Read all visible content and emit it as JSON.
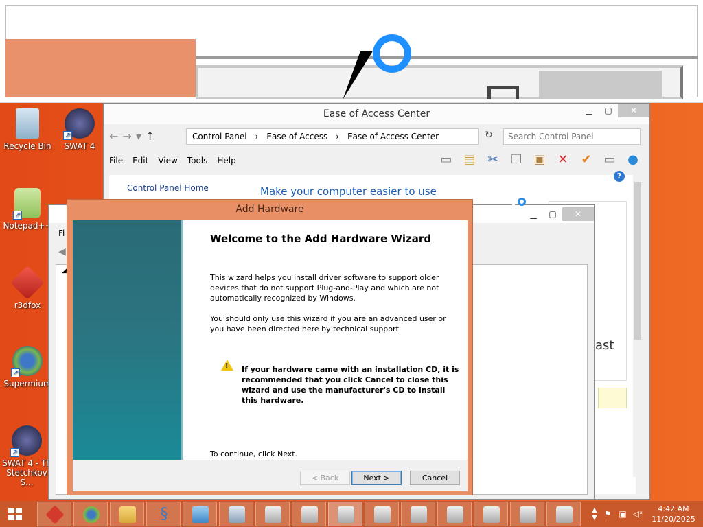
{
  "desktop": {
    "icons": [
      {
        "label": "Recycle Bin",
        "icon": "recycle-bin-icon"
      },
      {
        "label": "SWAT 4",
        "icon": "swat4-icon"
      },
      {
        "label": "Notepad++",
        "icon": "notepadpp-icon"
      },
      {
        "label": "r3dfox",
        "icon": "r3dfox-icon"
      },
      {
        "label": "Supermium",
        "icon": "supermium-icon"
      },
      {
        "label": "SWAT 4 - Th Stetchkov S...",
        "icon": "swat4-expansion-icon"
      }
    ]
  },
  "ease_of_access": {
    "title": "Ease of Access Center",
    "address": [
      "Control Panel",
      "Ease of Access",
      "Ease of Access Center"
    ],
    "search_placeholder": "Search Control Panel",
    "menu": [
      "File",
      "Edit",
      "View",
      "Tools",
      "Help"
    ],
    "sidebar_link": "Control Panel Home",
    "heading": "Make your computer easier to use",
    "partial_text": "ast"
  },
  "device_manager": {
    "menu_partial": "Fi"
  },
  "wizard": {
    "title": "Add Hardware",
    "heading": "Welcome to the Add Hardware Wizard",
    "paragraph1": "This wizard helps you install driver software to support older devices that do not support Plug-and-Play and which are not automatically recognized by Windows.",
    "paragraph2": "You should only use this wizard if you are an advanced user or you have been directed here by technical support.",
    "warning": "If your hardware came with an installation CD, it is recommended that you click Cancel to close this wizard and use the manufacturer's CD to install this hardware.",
    "continue": "To continue, click Next.",
    "back_label": "< Back",
    "next_label": "Next >",
    "cancel_label": "Cancel"
  },
  "taskbar": {
    "time": "4:42 AM",
    "date": "11/20/2025",
    "items": [
      "r3dfox",
      "Supermium",
      "File Explorer",
      "Swan app",
      "Control Panel",
      "Device Manager",
      "Hardware wizard",
      "Hardware wizard",
      "Hardware wizard",
      "Hardware wizard",
      "Hardware wizard",
      "Hardware wizard",
      "Hardware wizard",
      "Hardware wizard",
      "Hardware wizard"
    ]
  },
  "colors": {
    "desktop": "#e95b1e",
    "taskbar": "#c9582a",
    "wizard_frame": "#e98f65",
    "link": "#1a5fb4"
  }
}
